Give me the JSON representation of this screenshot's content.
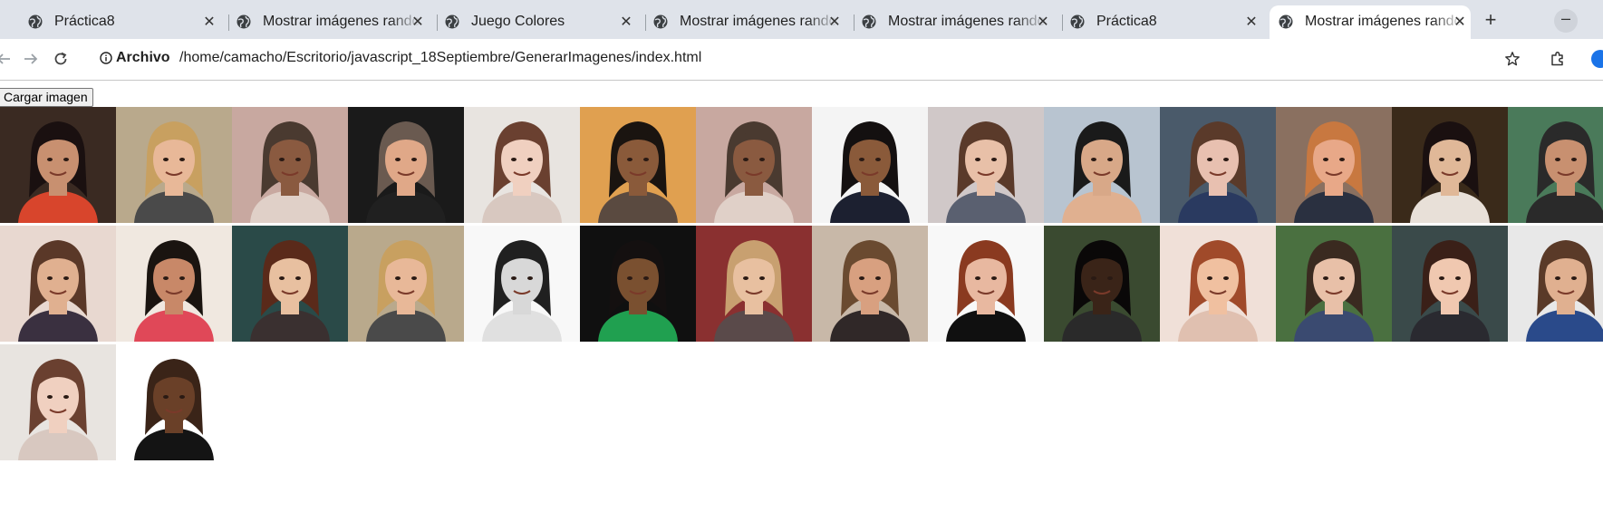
{
  "tabs": [
    {
      "title": "Práctica8",
      "active": false
    },
    {
      "title": "Mostrar imágenes random",
      "active": false
    },
    {
      "title": "Juego Colores",
      "active": false
    },
    {
      "title": "Mostrar imágenes random",
      "active": false
    },
    {
      "title": "Mostrar imágenes random",
      "active": false
    },
    {
      "title": "Práctica8",
      "active": false
    },
    {
      "title": "Mostrar imágenes random",
      "active": true
    }
  ],
  "toolbar": {
    "site_info_label": "Archivo",
    "url": "/home/camacho/Escritorio/javascript_18Septiembre/GenerarImagenes/index.html"
  },
  "page": {
    "load_button_label": "Cargar imagen"
  },
  "colors": {
    "tabstrip_bg": "#dfe3ea",
    "active_tab_bg": "#ffffff",
    "page_bg": "#ffffff"
  },
  "photos": [
    {
      "name": "woman-dark-hair-red-top",
      "bg": "#3a2a22",
      "skin": "#c89070",
      "hair": "#1a1010",
      "shirt": "#d8452c"
    },
    {
      "name": "man-blond-gray-shirt",
      "bg": "#b9a98c",
      "skin": "#e8b898",
      "hair": "#c8a060",
      "shirt": "#4a4a4a"
    },
    {
      "name": "woman-curly-hair-glasses",
      "bg": "#c8a8a0",
      "skin": "#8a5a40",
      "hair": "#4a3a30",
      "shirt": "#e0d0c8"
    },
    {
      "name": "man-gray-hair-suit",
      "bg": "#1a1a1a",
      "skin": "#e0a888",
      "hair": "#6a5a50",
      "shirt": "#202020"
    },
    {
      "name": "woman-brown-hair-light",
      "bg": "#e8e4e0",
      "skin": "#f0d0c0",
      "hair": "#6a4030",
      "shirt": "#d8c8c0"
    },
    {
      "name": "man-dark-hair-orange-bg",
      "bg": "#e0a050",
      "skin": "#8a5a3a",
      "hair": "#1a1410",
      "shirt": "#5a4a40"
    },
    {
      "name": "woman-curly-hair-glasses-2",
      "bg": "#c8a8a0",
      "skin": "#8a5a40",
      "hair": "#4a3a30",
      "shirt": "#e0d0c8"
    },
    {
      "name": "man-suit-white-bg",
      "bg": "#f4f4f4",
      "skin": "#8a5a3a",
      "hair": "#141010",
      "shirt": "#1c2030"
    },
    {
      "name": "woman-short-hair-smile",
      "bg": "#d0c8c8",
      "skin": "#e8c0a8",
      "hair": "#5a3a2a",
      "shirt": "#5a6070"
    },
    {
      "name": "man-glasses-beard",
      "bg": "#b8c4d0",
      "skin": "#d8a888",
      "hair": "#1a1a1a",
      "shirt": "#e0b090"
    },
    {
      "name": "woman-white-glasses",
      "bg": "#4a5a6a",
      "skin": "#e8c0b0",
      "hair": "#5a3a2a",
      "shirt": "#2a3a60"
    },
    {
      "name": "man-ginger-hair",
      "bg": "#8a7060",
      "skin": "#e8a888",
      "hair": "#c87840",
      "shirt": "#2a3040"
    },
    {
      "name": "woman-long-hair-dark-bg",
      "bg": "#3a2a1a",
      "skin": "#e0b898",
      "hair": "#1a1010",
      "shirt": "#e8e0d8"
    },
    {
      "name": "man-hat-beard",
      "bg": "#4a7a5a",
      "skin": "#c89070",
      "hair": "#2a2a2a",
      "shirt": "#2a2a2a"
    },
    {
      "name": "woman-long-wavy-hair",
      "bg": "#e8d8d0",
      "skin": "#e0b090",
      "hair": "#5a3828",
      "shirt": "#3a3040"
    },
    {
      "name": "man-glasses-pink-shirt",
      "bg": "#f0e8e0",
      "skin": "#c88868",
      "hair": "#1a1410",
      "shirt": "#e04858"
    },
    {
      "name": "woman-brown-hair-teal-bg",
      "bg": "#2a4a48",
      "skin": "#e8c0a0",
      "hair": "#5a2a1a",
      "shirt": "#3a3030"
    },
    {
      "name": "man-blond-gray-shirt-2",
      "bg": "#b9a98c",
      "skin": "#e8b898",
      "hair": "#c8a060",
      "shirt": "#4a4a4a"
    },
    {
      "name": "woman-bw-portrait",
      "bg": "#f8f8f8",
      "skin": "#d8d8d8",
      "hair": "#202020",
      "shirt": "#e0e0e0"
    },
    {
      "name": "man-green-shirt",
      "bg": "#101010",
      "skin": "#7a5030",
      "hair": "#141010",
      "shirt": "#20a050"
    },
    {
      "name": "woman-blonde-curly",
      "bg": "#8a3030",
      "skin": "#e8c0a0",
      "hair": "#c8a070",
      "shirt": "#5a4a4a"
    },
    {
      "name": "man-beard-outdoors",
      "bg": "#c8b8a8",
      "skin": "#d8a080",
      "hair": "#6a4a30",
      "shirt": "#302828"
    },
    {
      "name": "woman-short-hair-white-bg",
      "bg": "#f8f8f8",
      "skin": "#e8b8a0",
      "hair": "#8a3a20",
      "shirt": "#101010"
    },
    {
      "name": "man-dark-green-bg",
      "bg": "#3a4a30",
      "skin": "#3a2418",
      "hair": "#0a0808",
      "shirt": "#2a2a2a"
    },
    {
      "name": "woman-curly-red-hair",
      "bg": "#f0e0d8",
      "skin": "#f0c0a0",
      "hair": "#a04a2a",
      "shirt": "#e0c0b0"
    },
    {
      "name": "man-short-hair-green-bg",
      "bg": "#4a7040",
      "skin": "#e8c0a8",
      "hair": "#3a2a20",
      "shirt": "#3a4a70"
    },
    {
      "name": "woman-laughing-dark-hair",
      "bg": "#3a4a4a",
      "skin": "#f0c8b0",
      "hair": "#3a2018",
      "shirt": "#2a2a30"
    },
    {
      "name": "man-plaid-shirt",
      "bg": "#e8e8e8",
      "skin": "#e0b090",
      "hair": "#5a3a28",
      "shirt": "#2a4a8a"
    },
    {
      "name": "woman-brown-hair-light-2",
      "bg": "#e8e4e0",
      "skin": "#f0d0c0",
      "hair": "#6a4030",
      "shirt": "#d8c8c0"
    },
    {
      "name": "man-bald-black-shirt",
      "bg": "#ffffff",
      "skin": "#6a4028",
      "hair": "#3a2418",
      "shirt": "#141414"
    }
  ]
}
